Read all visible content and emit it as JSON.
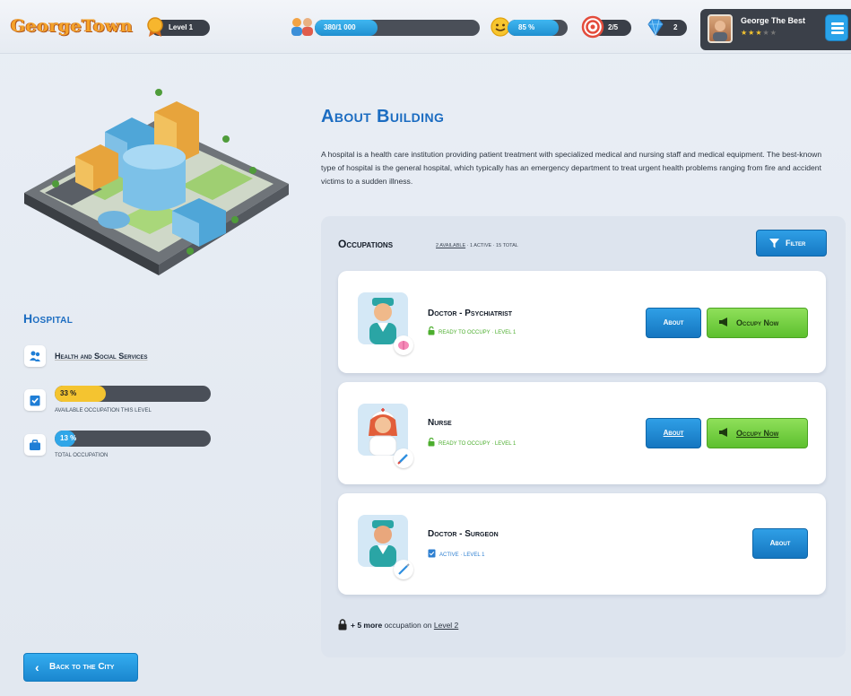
{
  "header": {
    "logo": "GeorgeTown",
    "level": "Level 1",
    "population": {
      "text": "380/1 000",
      "fraction": 0.38
    },
    "happiness": {
      "text": "85 %",
      "fraction": 0.85
    },
    "targets": "2/5",
    "gems": "2",
    "profile": {
      "name": "George The Best",
      "stars_filled": 3,
      "stars_total": 5
    }
  },
  "sidebar": {
    "title": "Hospital",
    "service": "Health and Social Services",
    "occupation_level": {
      "label": "33 %",
      "fraction": 0.33,
      "caption": "Available occupation this level"
    },
    "occupation_total": {
      "label": "13 %",
      "fraction": 0.13,
      "caption": "Total occupation"
    },
    "back_button": "Back to the City"
  },
  "about": {
    "title": "About Building",
    "description": "A hospital is a health care institution providing patient treatment with specialized medical and nursing staff and medical equipment. The best-known type of hospital is the general hospital, which typically has an emergency department to treat urgent health problems ranging from fire and accident victims to a sudden illness."
  },
  "occupations": {
    "title": "Occupations",
    "summary_available": "2 available",
    "summary_rest": " · 1 active · 15 total",
    "filter_label": "Filter",
    "items": [
      {
        "title": "Doctor - Psychiatrist",
        "status": "Ready to occupy · Level 1",
        "about": "About",
        "occupy": "Occupy Now"
      },
      {
        "title": "Nurse",
        "status": "Ready to occupy · Level 1",
        "about": "About",
        "occupy": "Occupy Now"
      },
      {
        "title": "Doctor - Surgeon",
        "status": "Active · Level 1",
        "about": "About"
      }
    ],
    "more_bold": "+ 5 more",
    "more_text": " occupation on ",
    "more_level": "Level 2"
  },
  "colors": {
    "brand_blue": "#1b6cc1",
    "button_blue": "#1f8fd8",
    "button_green": "#6fcc3a",
    "bar_yellow": "#f4c430",
    "bar_blue": "#2fa6e8"
  }
}
